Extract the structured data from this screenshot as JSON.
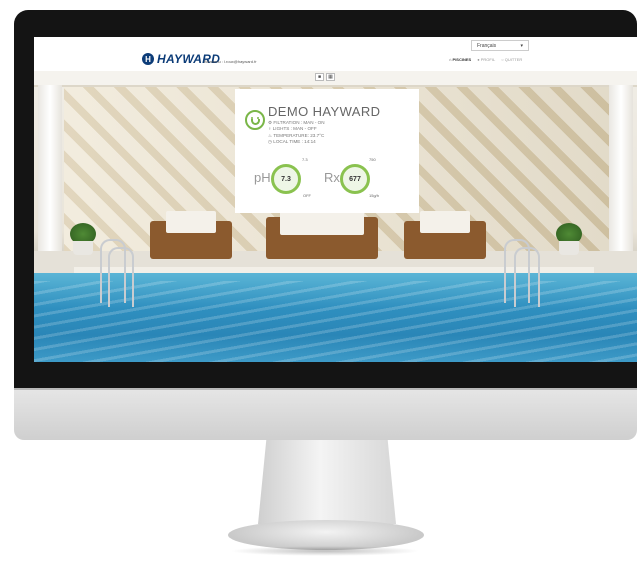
{
  "header": {
    "brand": "HAYWARD",
    "welcome": "Bienvenu : l.roux@hayward.fr",
    "language_select": "Français",
    "nav": [
      "PISCINES",
      "PROFIL",
      "QUITTER"
    ]
  },
  "view_toggle": [
    "■",
    "▦"
  ],
  "status_card": {
    "title": "DEMO HAYWARD",
    "info": [
      "FILTRATION : MAN - ON",
      "LIGHTS : MAN - OFF",
      "TEMPERATURE: 23.7°C",
      "LOCAL TIME : 14:14"
    ],
    "ph": {
      "label": "pH",
      "value": "7.3",
      "target": "7.3",
      "status": "OFF"
    },
    "rx": {
      "label": "Rx",
      "value": "677",
      "target": "750",
      "status": "15g/h"
    }
  },
  "colors": {
    "brand": "#0c3c78",
    "ok_green": "#7ab648",
    "water": "#2f8fbf"
  }
}
